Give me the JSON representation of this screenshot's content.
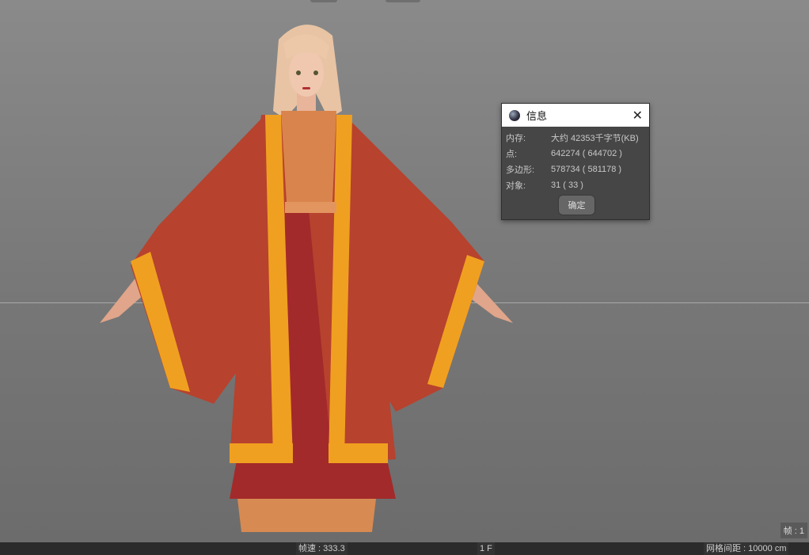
{
  "dialog": {
    "title": "信息",
    "close_icon": "close-icon",
    "rows": [
      {
        "label": "内存:",
        "value": "大约 42353千字节(KB)"
      },
      {
        "label": "点:",
        "value": "642274 ( 644702 )"
      },
      {
        "label": "多边形:",
        "value": "578734 ( 581178 )"
      },
      {
        "label": "对象:",
        "value": "31 ( 33 )"
      }
    ],
    "ok_label": "确定"
  },
  "status": {
    "fps": "帧速 : 333.3",
    "frame": "1 F",
    "grid": "网格间距 : 10000 cm",
    "frame_badge": "帧 : 1"
  }
}
